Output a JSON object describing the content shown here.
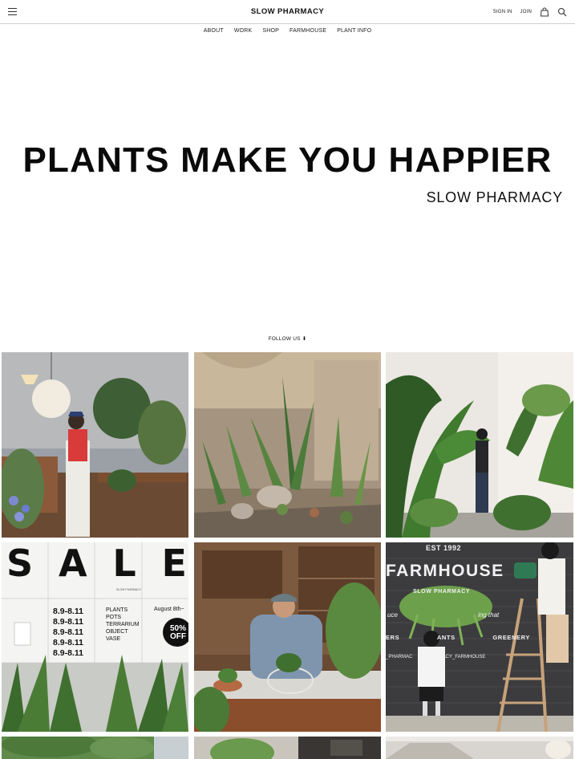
{
  "header": {
    "brand": "SLOW PHARMACY",
    "sign_in": "SIGN IN",
    "join": "JOIN",
    "icons": [
      "menu-icon",
      "shopping-bag-icon",
      "search-icon"
    ]
  },
  "nav": {
    "items": [
      {
        "label": "ABOUT"
      },
      {
        "label": "WORK"
      },
      {
        "label": "SHOP"
      },
      {
        "label": "FARMHOUSE"
      },
      {
        "label": "PLANT INFO"
      }
    ]
  },
  "hero": {
    "title": "PLANTS MAKE YOU HAPPIER",
    "subtitle": "SLOW PHARMACY"
  },
  "follow": {
    "label": "FOLLOW US",
    "arrow": "⬇"
  },
  "sale_poster": {
    "letters": [
      "S",
      "A",
      "L",
      "E"
    ],
    "dates": [
      "8.9-8.11",
      "8.9-8.11",
      "8.9-8.11",
      "8.9-8.11",
      "8.9-8.11"
    ],
    "items": [
      "PLANTS",
      "POTS",
      "TERRARIUM",
      "OBJECT",
      "VASE"
    ],
    "date_label": "August 8th~",
    "discount_top": "50%",
    "discount_bottom": "OFF",
    "small_label": "SLOW PHARMACY"
  },
  "farmhouse_sign": {
    "established": "EST 1992",
    "name": "FARMHOUSE",
    "brand": "SLOW PHARMACY",
    "tagline_left": "uce",
    "tagline_right": "ing that",
    "row": [
      "ERS",
      "ANTS",
      "GREENERY"
    ],
    "handle": "_PHARMAC      WPHARMACY_FARMHOUSE"
  },
  "colors": {
    "text": "#111111",
    "divider": "#cfcfcf",
    "background": "#ffffff"
  }
}
